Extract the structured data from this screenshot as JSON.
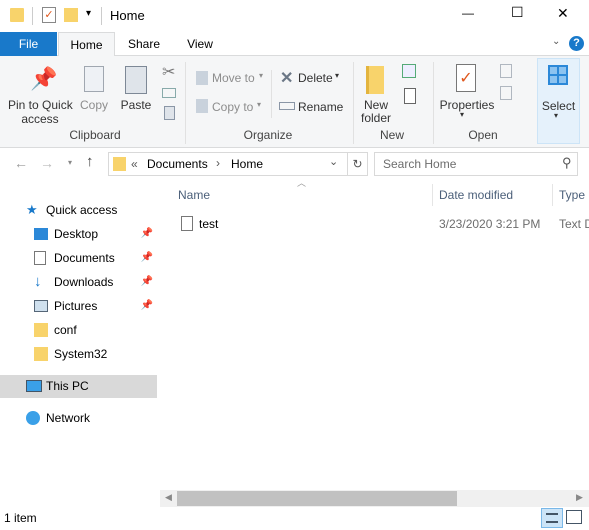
{
  "window": {
    "title": "Home",
    "minimize": "—",
    "maximize": "☐",
    "close": "✕"
  },
  "tabs": [
    {
      "label": "File"
    },
    {
      "label": "Home"
    },
    {
      "label": "Share"
    },
    {
      "label": "View"
    }
  ],
  "help": "?",
  "ribbon": {
    "clipboard": {
      "group": "Clipboard",
      "pin": "Pin to Quick access",
      "pin1": "Pin to Quick",
      "pin2": "access",
      "copy": "Copy",
      "paste": "Paste"
    },
    "organize": {
      "group": "Organize",
      "move_to": "Move to",
      "copy_to": "Copy to",
      "delete": "Delete",
      "rename": "Rename"
    },
    "new": {
      "group": "New",
      "new_folder1": "New",
      "new_folder2": "folder"
    },
    "open": {
      "group": "Open",
      "properties": "Properties"
    },
    "select": {
      "label": "Select"
    }
  },
  "address": {
    "prefix": "«",
    "path": [
      "Documents",
      "Home"
    ],
    "separator": "›"
  },
  "search": {
    "placeholder": "Search Home"
  },
  "nav": {
    "items": [
      {
        "label": "Quick access",
        "icon": "star-icon"
      },
      {
        "label": "Desktop",
        "icon": "desktop-icon",
        "pinned": true
      },
      {
        "label": "Documents",
        "icon": "documents-icon",
        "pinned": true
      },
      {
        "label": "Downloads",
        "icon": "download-icon",
        "pinned": true
      },
      {
        "label": "Pictures",
        "icon": "pictures-icon",
        "pinned": true
      },
      {
        "label": "conf",
        "icon": "folder-icon"
      },
      {
        "label": "System32",
        "icon": "folder-icon"
      },
      {
        "label": "This PC",
        "icon": "computer-icon",
        "selected": true
      },
      {
        "label": "Network",
        "icon": "network-icon"
      }
    ]
  },
  "columns": {
    "name": "Name",
    "date": "Date modified",
    "type": "Type"
  },
  "files": [
    {
      "name": "test",
      "date": "3/23/2020 3:21 PM",
      "type": "Text D"
    }
  ],
  "status": {
    "count": "1 item"
  },
  "colors": {
    "accent": "#1979ca",
    "selected": "#d9d9d9"
  }
}
